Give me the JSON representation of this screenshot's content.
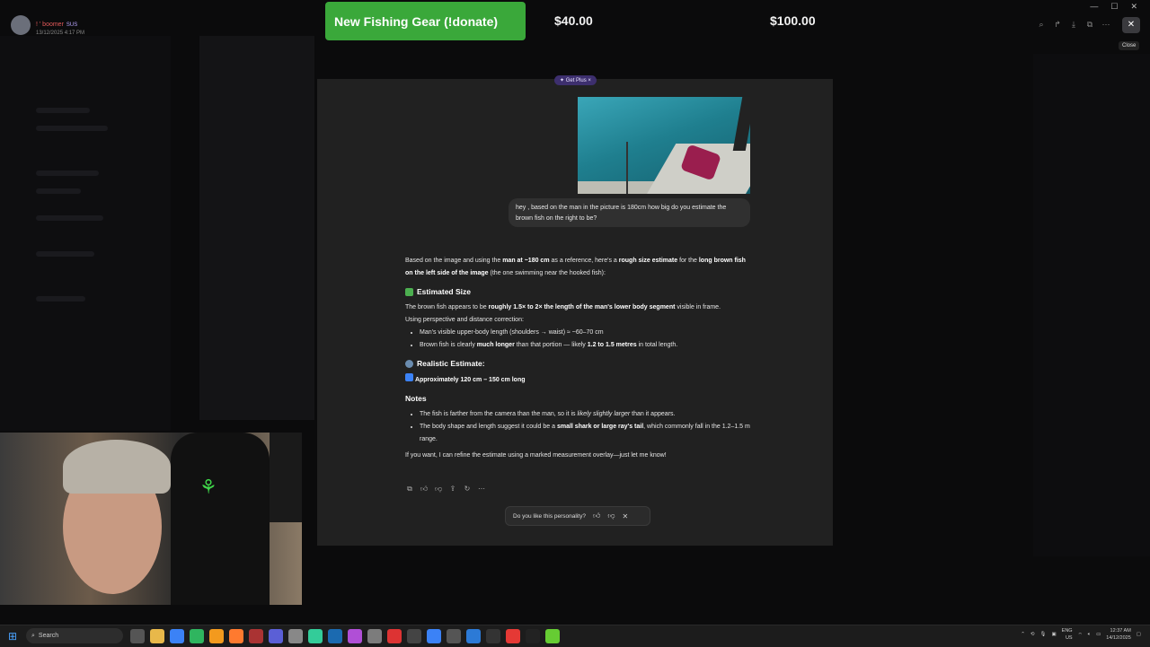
{
  "stream": {
    "user_name": "! ' boomer",
    "user_badge": "SUS",
    "user_date": "13/12/2025 4:17 PM",
    "donation_label": "New Fishing Gear (!donate)",
    "amount_current": "$40.00",
    "amount_goal": "$100.00"
  },
  "viewer": {
    "close_tooltip": "Close"
  },
  "chat": {
    "get_plus": "✦ Get Plus ×",
    "user_message": "hey , based on the man in the picture is 180cm how big do you estimate the brown fish on the right to be?",
    "intro_a": "Based on the image and using the ",
    "intro_b": "man at ~180 cm",
    "intro_c": " as a reference, here's a ",
    "intro_d": "rough size estimate",
    "intro_e": " for the ",
    "intro_f": "long brown fish on the left side of the image",
    "intro_g": " (the one swimming near the hooked fish):",
    "h_estimated": "Estimated Size",
    "est_a": "The brown fish appears to be ",
    "est_b": "roughly 1.5× to 2× the length of the man's lower body segment",
    "est_c": " visible in frame.",
    "perspective": "Using perspective and distance correction:",
    "bullet1": "Man's visible upper-body length (shoulders → waist) ≈ ~60–70 cm",
    "bullet2_a": "Brown fish is clearly ",
    "bullet2_b": "much longer",
    "bullet2_c": " than that portion — likely ",
    "bullet2_d": "1.2 to 1.5 metres",
    "bullet2_e": " in total length.",
    "h_realistic": "Realistic Estimate:",
    "realistic": "Approximately 120 cm – 150 cm long",
    "h_notes": "Notes",
    "note1_a": "The fish is farther from the camera than the man, so it is ",
    "note1_b": "likely slightly larger",
    "note1_c": " than it appears.",
    "note2_a": "The body shape and length suggest it could be a ",
    "note2_b": "small shark or large ray's tail",
    "note2_c": ", which commonly fall in the 1.2–1.5 m range.",
    "closing": "If you want, I can refine the estimate using a marked measurement overlay—just let me know!",
    "feedback_q": "Do you like this personality?"
  },
  "taskbar": {
    "search": "Search",
    "lang": "ENG",
    "region": "US",
    "time": "12:37 AM",
    "date": "14/12/2025"
  },
  "colors": {
    "donate_bar": "#3aa83a",
    "card_bg": "#212121",
    "accent_purple": "#3d2f6e"
  }
}
